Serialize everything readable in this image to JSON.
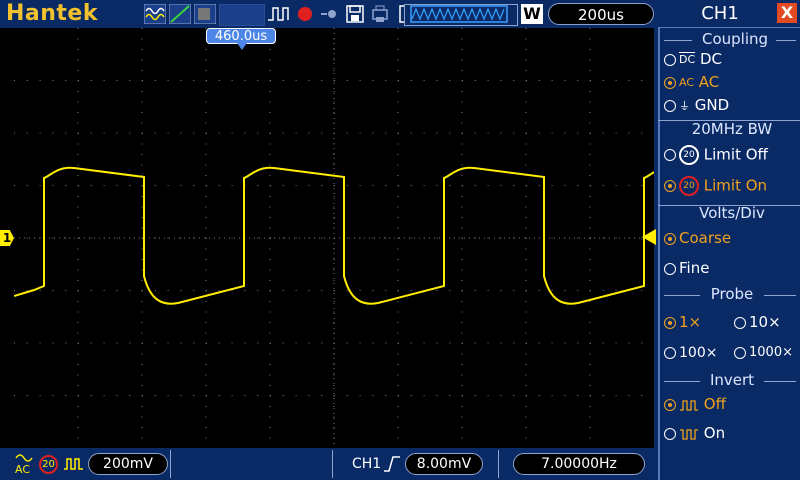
{
  "brand": "Hantek",
  "top": {
    "time_cursor": "460.0us",
    "timebase": "200us",
    "waveform_mode": "W"
  },
  "bottom": {
    "ch_volts": "200mV",
    "trigger_channel": "CH1",
    "trigger_level": "8.00mV",
    "frequency": "7.00000Hz",
    "bw_label": "20",
    "coupling_label": "AC"
  },
  "panel": {
    "title": "CH1",
    "close": "X",
    "coupling": {
      "title": "Coupling",
      "dc_icon": "DC",
      "dc": "DC",
      "ac_icon": "AC",
      "ac": "AC",
      "gnd": "GND",
      "selected": "AC"
    },
    "bandwidth": {
      "title": "20MHz BW",
      "icon": "20",
      "limit_off": "Limit Off",
      "limit_on": "Limit On",
      "selected": "Limit On"
    },
    "volts": {
      "title": "Volts/Div",
      "coarse": "Coarse",
      "fine": "Fine",
      "selected": "Coarse"
    },
    "probe": {
      "title": "Probe",
      "x1": "1×",
      "x10": "10×",
      "x100": "100×",
      "x1000": "1000×",
      "selected": "1×"
    },
    "invert": {
      "title": "Invert",
      "off": "Off",
      "on": "On",
      "selected": "Off"
    }
  },
  "channel_marker": "1",
  "colors": {
    "trace": "#ffee00",
    "accent": "#f0a21d",
    "panel_bg": "#0a2a66"
  }
}
